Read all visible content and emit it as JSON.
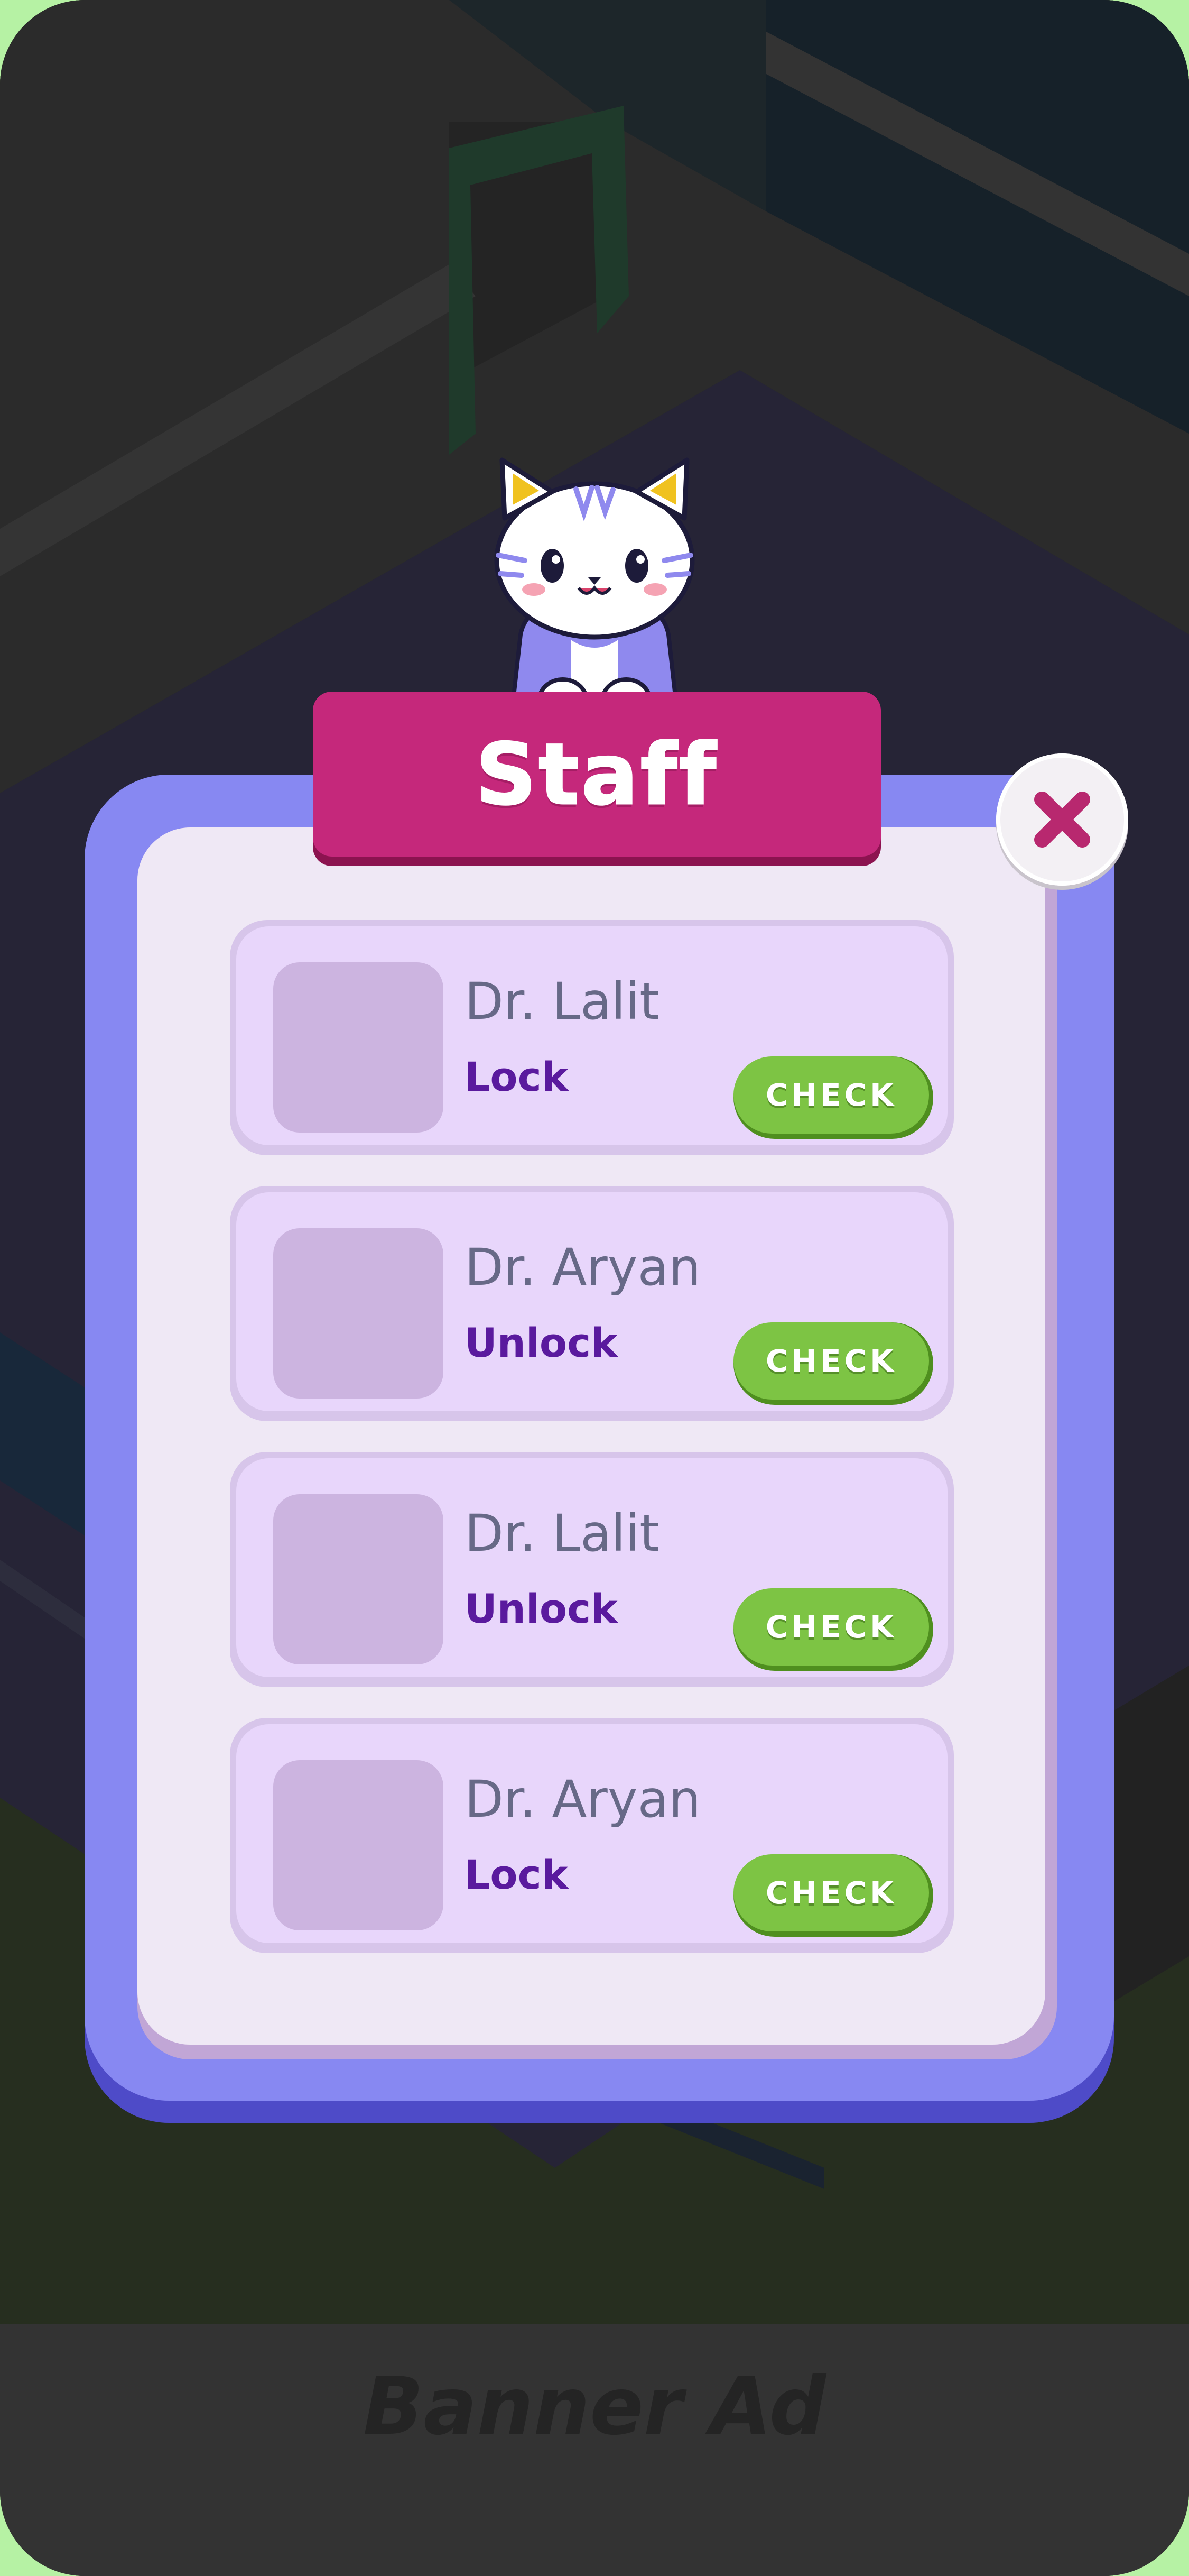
{
  "popup": {
    "title": "Staff",
    "close_icon": "close-x-icon",
    "mascot": "cat-mascot"
  },
  "staff": [
    {
      "name": "Dr. Lalit",
      "status": "Lock",
      "button": "CHECK"
    },
    {
      "name": "Dr. Aryan",
      "status": "Unlock",
      "button": "CHECK"
    },
    {
      "name": "Dr. Lalit",
      "status": "Unlock",
      "button": "CHECK"
    },
    {
      "name": "Dr. Aryan",
      "status": "Lock",
      "button": "CHECK"
    }
  ],
  "banner_ad": {
    "label": "Banner Ad"
  },
  "colors": {
    "title_banner": "#c5287b",
    "panel_frame": "#8788f2",
    "panel_inner": "#efe8f5",
    "card": "#e8d6fb",
    "check_button": "#7dc444",
    "status_text": "#5a1a9e",
    "close_x": "#b8286f"
  }
}
